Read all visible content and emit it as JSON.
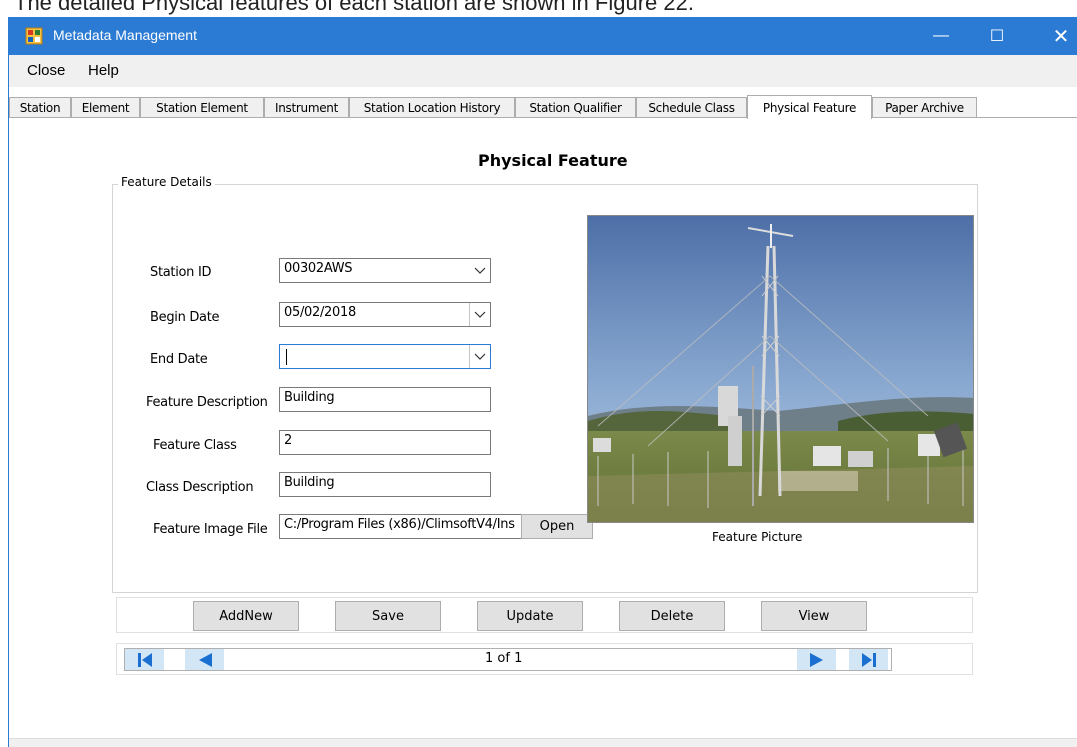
{
  "caption": "The detailed Physical features of each station are shown in Figure 22.",
  "window": {
    "title": "Metadata Management",
    "controls": {
      "minimize": "—",
      "maximize": "☐",
      "close": "✕"
    }
  },
  "menu": {
    "close": "Close",
    "help": "Help"
  },
  "tabs": [
    "Station",
    "Element",
    "Station Element",
    "Instrument",
    "Station Location History",
    "Station Qualifier",
    "Schedule Class",
    "Physical Feature",
    "Paper Archive"
  ],
  "active_tab": "Physical Feature",
  "form": {
    "title": "Physical Feature",
    "group_label": "Feature Details",
    "fields": {
      "station_id": {
        "label": "Station ID",
        "value": "00302AWS"
      },
      "begin_date": {
        "label": "Begin Date",
        "value": "05/02/2018"
      },
      "end_date": {
        "label": "End Date",
        "value": ""
      },
      "feature_description": {
        "label": "Feature Description",
        "value": "Building"
      },
      "feature_class": {
        "label": "Feature Class",
        "value": "2"
      },
      "class_description": {
        "label": "Class Description",
        "value": "Building"
      },
      "feature_image_file": {
        "label": "Feature Image File",
        "value": "C:/Program Files (x86)/ClimsoftV4/Ins"
      }
    },
    "open_button": "Open",
    "picture_caption": "Feature Picture"
  },
  "actions": {
    "addnew": "AddNew",
    "save": "Save",
    "update": "Update",
    "delete": "Delete",
    "view": "View"
  },
  "navigator": {
    "record_text": "1 of 1"
  },
  "colors": {
    "titlebar": "#2b7ad3",
    "menubar": "#f0f0f0",
    "button_face": "#e1e1e1",
    "nav_button": "#d2e6f5",
    "nav_arrow": "#1a6fd0"
  },
  "icons": {
    "app": "app-icon",
    "first": "first-record-icon",
    "prev": "previous-record-icon",
    "next": "next-record-icon",
    "last": "last-record-icon",
    "dropdown": "chevron-down-icon"
  }
}
